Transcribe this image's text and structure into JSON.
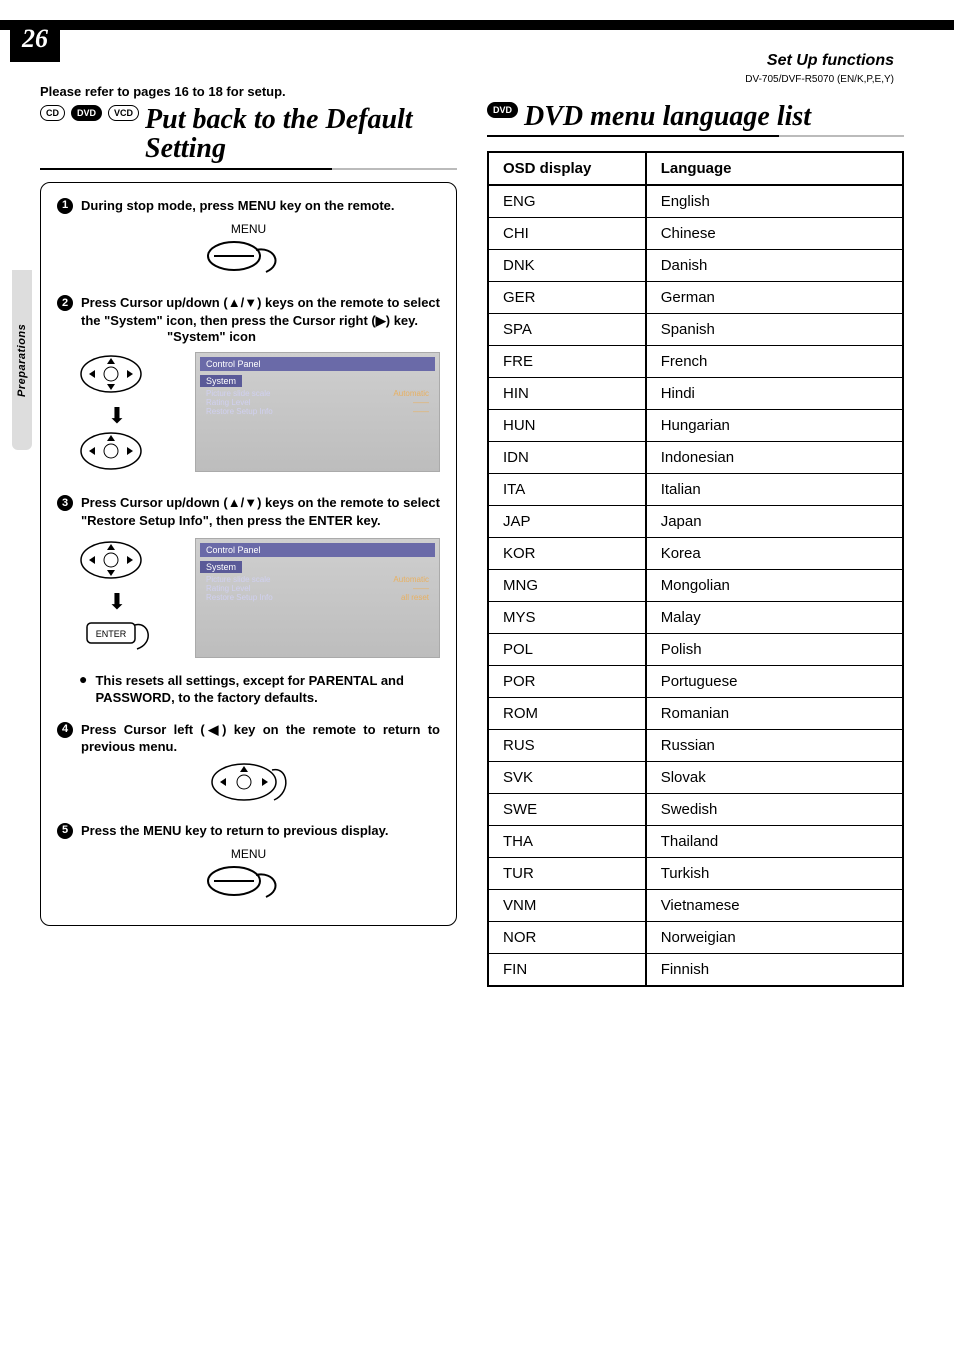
{
  "page_number": "26",
  "header": {
    "section": "Set Up functions",
    "model": "DV-705/DVF-R5070 (EN/K,P,E,Y)",
    "side_tab": "Preparations"
  },
  "left": {
    "setup_note": "Please refer to pages 16 to 18 for setup.",
    "badges": [
      "CD",
      "DVD",
      "VCD"
    ],
    "title": "Put back to the Default Setting",
    "steps": [
      {
        "num": "1",
        "text": "During stop mode, press MENU key on the remote.",
        "menu_label": "MENU"
      },
      {
        "num": "2",
        "text": "Press Cursor up/down (▲/▼) keys on the remote to select the \"System\" icon, then press the Cursor right (▶) key.",
        "icon_label": "\"System\" icon",
        "panel_title": "Control Panel",
        "panel_section": "System",
        "panel_rows": [
          {
            "k": "Picture slide scale",
            "v": "Automatic"
          },
          {
            "k": "Rating Level",
            "v": "——"
          },
          {
            "k": "Restore Setup Info",
            "v": "——"
          }
        ]
      },
      {
        "num": "3",
        "text": "Press Cursor up/down (▲/▼) keys on the remote to select \"Restore Setup Info\", then press the ENTER key.",
        "enter_label": "ENTER",
        "panel_title": "Control Panel",
        "panel_section": "System",
        "panel_rows": [
          {
            "k": "Picture slide scale",
            "v": "Automatic"
          },
          {
            "k": "Rating Level",
            "v": "——"
          },
          {
            "k": "Restore Setup Info",
            "v": "all reset"
          }
        ]
      },
      {
        "note": "This resets all settings, except for PARENTAL and PASSWORD, to the factory defaults."
      },
      {
        "num": "4",
        "text": "Press Cursor left (◀) key on the remote to return to previous menu."
      },
      {
        "num": "5",
        "text": "Press the MENU key to return to previous display.",
        "menu_label": "MENU"
      }
    ]
  },
  "right": {
    "badges": [
      "DVD"
    ],
    "title": "DVD menu language list",
    "table_headers": [
      "OSD display",
      "Language"
    ],
    "rows": [
      [
        "ENG",
        "English"
      ],
      [
        "CHI",
        "Chinese"
      ],
      [
        "DNK",
        "Danish"
      ],
      [
        "GER",
        "German"
      ],
      [
        "SPA",
        "Spanish"
      ],
      [
        "FRE",
        "French"
      ],
      [
        "HIN",
        "Hindi"
      ],
      [
        "HUN",
        "Hungarian"
      ],
      [
        "IDN",
        "Indonesian"
      ],
      [
        "ITA",
        "Italian"
      ],
      [
        "JAP",
        "Japan"
      ],
      [
        "KOR",
        "Korea"
      ],
      [
        "MNG",
        "Mongolian"
      ],
      [
        "MYS",
        "Malay"
      ],
      [
        "POL",
        "Polish"
      ],
      [
        "POR",
        "Portuguese"
      ],
      [
        "ROM",
        "Romanian"
      ],
      [
        "RUS",
        "Russian"
      ],
      [
        "SVK",
        "Slovak"
      ],
      [
        "SWE",
        "Swedish"
      ],
      [
        "THA",
        "Thailand"
      ],
      [
        "TUR",
        "Turkish"
      ],
      [
        "VNM",
        "Vietnamese"
      ],
      [
        "NOR",
        "Norweigian"
      ],
      [
        "FIN",
        "Finnish"
      ]
    ]
  }
}
